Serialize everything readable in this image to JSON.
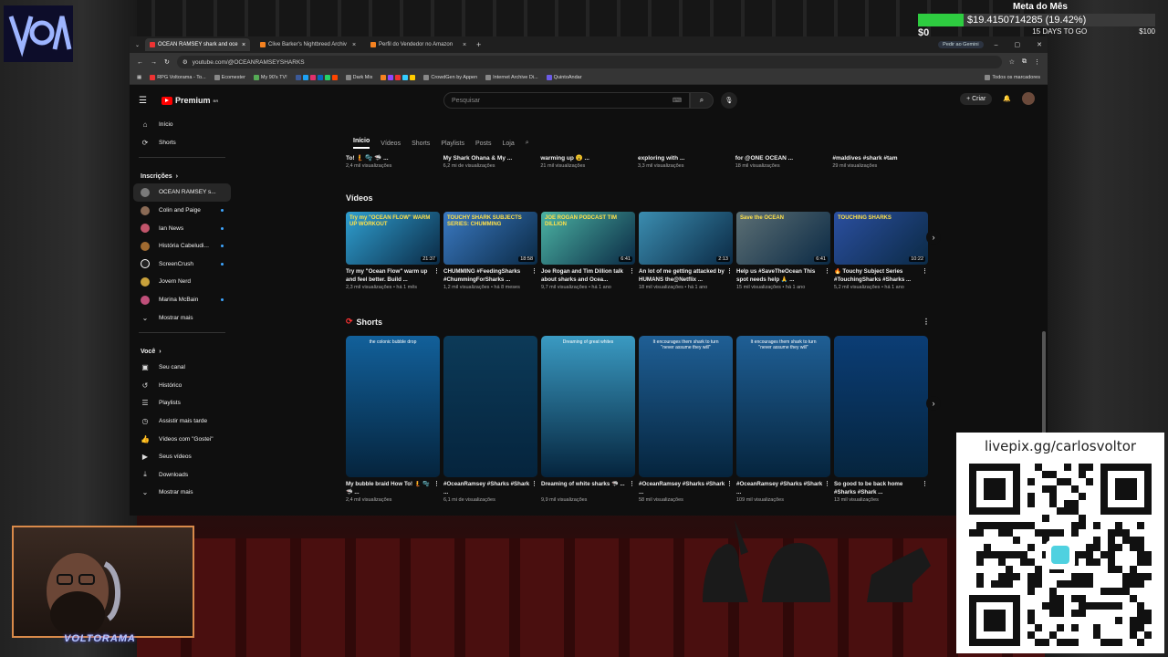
{
  "browser": {
    "tabs": [
      {
        "label": "OCEAN RAMSEY shark and oce",
        "active": true
      },
      {
        "label": "Clive Barker's Nightbreed Archiv",
        "active": false
      },
      {
        "label": "Perfil do Vendedor no Amazon",
        "active": false
      }
    ],
    "gemini_label": "Pedir ao Gemini",
    "url": "youtube.com/@OCEANRAMSEYSHARKS",
    "bookmarks": [
      "RPG Voltorama - To...",
      "Ecomester",
      "My 90's TV!",
      "Dark Mix",
      "CrowdGen by Appen",
      "Internet Archive Di...",
      "QuintoAndar"
    ],
    "all_bookmarks": "Todos os marcadores"
  },
  "youtube": {
    "logo": "Premium",
    "logo_region": "BR",
    "search_placeholder": "Pesquisar",
    "create_label": "Criar",
    "sidebar": {
      "main": [
        {
          "label": "Início",
          "icon": "home-icon"
        },
        {
          "label": "Shorts",
          "icon": "shorts-icon"
        }
      ],
      "subs_title": "Inscrições",
      "subs": [
        {
          "label": "OCEAN RAMSEY s...",
          "color": "#7a7a7a",
          "dot": false
        },
        {
          "label": "Colin and Paige",
          "color": "#8a6a55",
          "dot": true
        },
        {
          "label": "Ian News",
          "color": "#c2556b",
          "dot": true
        },
        {
          "label": "História Cabeludi...",
          "color": "#a06a30",
          "dot": true
        },
        {
          "label": "ScreenCrush",
          "color": "#222222",
          "dot": true
        },
        {
          "label": "Jovem Nerd",
          "color": "#c9a13b",
          "dot": false
        },
        {
          "label": "Marina McBain",
          "color": "#c04f7a",
          "dot": true
        }
      ],
      "show_more": "Mostrar mais",
      "you_title": "Você",
      "you": [
        {
          "label": "Seu canal",
          "icon": "channel-icon"
        },
        {
          "label": "Histórico",
          "icon": "history-icon"
        },
        {
          "label": "Playlists",
          "icon": "playlists-icon"
        },
        {
          "label": "Assistir mais tarde",
          "icon": "watch-later-icon"
        },
        {
          "label": "Vídeos com \"Gostei\"",
          "icon": "like-icon"
        },
        {
          "label": "Seus vídeos",
          "icon": "video-icon"
        },
        {
          "label": "Downloads",
          "icon": "download-icon"
        }
      ],
      "show_more_2": "Mostrar mais"
    },
    "channel_tabs": [
      "Início",
      "Vídeos",
      "Shorts",
      "Playlists",
      "Posts",
      "Loja"
    ],
    "top_row": [
      {
        "title": "To! 🧜 🫧 🦈 ...",
        "meta": "2,4 mil visualizações"
      },
      {
        "title": "My Shark Ohana & My ...",
        "meta": "6,2 mi de visualizações"
      },
      {
        "title": "warming up 😮 ...",
        "meta": "21 mil visualizações"
      },
      {
        "title": "exploring with ...",
        "meta": "3,3 mil visualizações"
      },
      {
        "title": "for @ONE OCEAN ...",
        "meta": "18 mil visualizações"
      },
      {
        "title": "#maldives #shark #tam",
        "meta": "29 mil visualizações"
      }
    ],
    "videos_title": "Vídeos",
    "videos": [
      {
        "title": "Try my \"Ocean Flow\" warm up and feel better. Build ...",
        "meta": "2,3 mil visualizações • há 1 mês",
        "duration": "21:37",
        "thumb": "Try my \"OCEAN FLOW\" WARM UP WORKOUT",
        "bg": "#2f9fd0"
      },
      {
        "title": "CHUMMING #FeedingSharks #ChummingForSharks ...",
        "meta": "1,2 mil visualizações • há 8 meses",
        "duration": "18:58",
        "thumb": "TOUCHY SHARK SUBJECTS SERIES: CHUMMING",
        "bg": "#3a79c2"
      },
      {
        "title": "Joe Rogan and Tim Dillion talk about sharks and Ocea...",
        "meta": "9,7 mil visualizações • há 1 ano",
        "duration": "6:41",
        "thumb": "JOE ROGAN PODCAST TIM DILLION",
        "bg": "#4bb3a3"
      },
      {
        "title": "An lot of me getting attacked by HUMANS the@Netflix ...",
        "meta": "18 mil visualizações • há 1 ano",
        "duration": "2:13",
        "thumb": "",
        "bg": "#3b8db0"
      },
      {
        "title": "Help us #SaveTheOcean This spot needs help 🙏 ...",
        "meta": "15 mil visualizações • há 1 ano",
        "duration": "6:41",
        "thumb": "Save the OCEAN",
        "bg": "#5c6f74"
      },
      {
        "title": "🔥 Touchy Subject Series #TouchingSharks #Sharks ...",
        "meta": "5,2 mil visualizações • há 1 ano",
        "duration": "10:22",
        "thumb": "TOUCHING SHARKS",
        "bg": "#2b4fa0"
      }
    ],
    "shorts_title": "Shorts",
    "shorts": [
      {
        "title": "My bubble braid How To! 🧜 🫧 🦈 ...",
        "meta": "2,4 mil visualizações",
        "caption": "the colonic bubble drop",
        "bg": "#12609a"
      },
      {
        "title": "#OceanRamsey #Sharks #Shark ...",
        "meta": "6,1 mi de visualizações",
        "caption": "",
        "bg": "#0c3a58"
      },
      {
        "title": "Dreaming of white sharks 🦈 ...",
        "meta": "9,9 mil visualizações",
        "caption": "Dreaming of great whites",
        "bg": "#3a9ac2"
      },
      {
        "title": "#OceanRamsey #Sharks #Shark ...",
        "meta": "58 mil visualizações",
        "caption": "It encourages them shark to turn \"never assume they will\"",
        "bg": "#1f5f95"
      },
      {
        "title": "#OceanRamsey #Sharks #Shark ...",
        "meta": "109 mil visualizações",
        "caption": "It encourages them shark to turn \"never assume they will\"",
        "bg": "#1f5f95"
      },
      {
        "title": "So good to be back home #Sharks #Shark ...",
        "meta": "13 mil visualizações",
        "caption": "",
        "bg": "#0b3d75"
      }
    ]
  },
  "stream": {
    "goal_title": "Meta do Mês",
    "goal_amount": "$19.4150714285 (19.42%)",
    "goal_fraction": 0.1942,
    "goal_start": "$0",
    "goal_days": "15 DAYS TO GO",
    "goal_end": "$100",
    "qr_url": "livepix.gg/carlosvoltor",
    "cam_logo": "VOLTORAMA"
  }
}
